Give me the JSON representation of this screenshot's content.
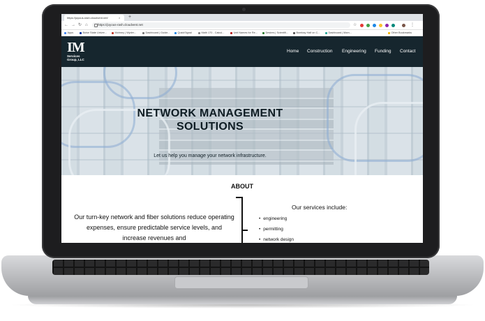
{
  "browser": {
    "tab_title": "https://joyous-rash.cloudvent.net/",
    "tab_close": "×",
    "new_tab": "+",
    "url": "https://joyous-rash.cloudvent.net",
    "bookmarks": [
      {
        "label": "Apps",
        "color": "#4285f4"
      },
      {
        "label": "Boise State Univer...",
        "color": "#0033a0"
      },
      {
        "label": "Mohney | Wyder...",
        "color": "#c0392b"
      },
      {
        "label": "Dashboard | Guide...",
        "color": "#777777"
      },
      {
        "label": "QuickSignal",
        "color": "#1e88e5"
      },
      {
        "label": "Math 170 - Calcul...",
        "color": "#888888"
      },
      {
        "label": "Unit Names for Re...",
        "color": "#b71c1c"
      },
      {
        "label": "Desires | Scientifi...",
        "color": "#2e7d32"
      },
      {
        "label": "Bombay Half on C...",
        "color": "#555555"
      },
      {
        "label": "Dashboard | Mam...",
        "color": "#26a69a"
      },
      {
        "label": "Other Bookmarks",
        "color": "#f4b400"
      }
    ]
  },
  "site": {
    "logo_mark": "IM",
    "logo_sub": "Services Group, LLC",
    "nav": [
      "Home",
      "Construction",
      "Engineering",
      "Funding",
      "Contact"
    ],
    "hero_title": "NETWORK MANAGEMENT SOLUTIONS",
    "hero_subtitle": "Let us help you manage your network infrastructure.",
    "about_title": "ABOUT",
    "about_text": "Our turn-key network and fiber solutions reduce operating expenses, ensure predictable service levels, and increase revenues and",
    "services_title": "Our services include:",
    "services": [
      "engineering",
      "permitting",
      "network design"
    ]
  },
  "colors": {
    "header_bg": "#16262e",
    "text_dark": "#0f1d24"
  }
}
